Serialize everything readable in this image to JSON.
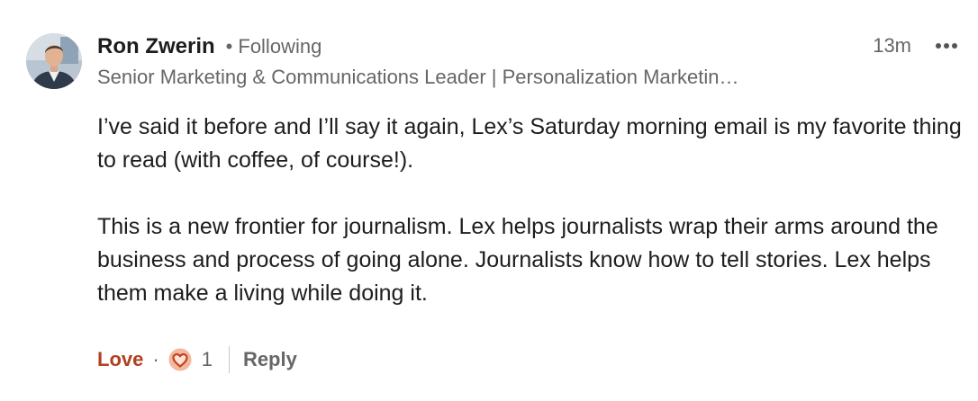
{
  "comment": {
    "author": {
      "name": "Ron Zwerin",
      "follow_separator": "•",
      "follow_status": "Following",
      "headline": "Senior Marketing & Communications Leader | Personalization Marketin…",
      "avatar_icon": "profile-photo"
    },
    "timestamp": "13m",
    "more_icon": "ellipsis-horizontal-icon",
    "paragraphs": [
      "I’ve said it before and I’ll say it again, Lex’s Saturday morning email is my favorite thing to read (with coffee, of course!).",
      "This is a new frontier for journalism. Lex helps journalists wrap their arms around the business and process of going alone. Journalists know how to tell stories. Lex helps them make a living while doing it."
    ],
    "actions": {
      "love_label": "Love",
      "separator": "·",
      "reaction_icon": "love-heart-icon",
      "reaction_count": "1",
      "reply_label": "Reply"
    }
  },
  "colors": {
    "love_accent": "#b24020",
    "reaction_badge": "#f4b8a0",
    "reaction_heart_stroke": "#c2451f",
    "secondary_text": "#666666",
    "primary_text": "#1d1d1d"
  }
}
